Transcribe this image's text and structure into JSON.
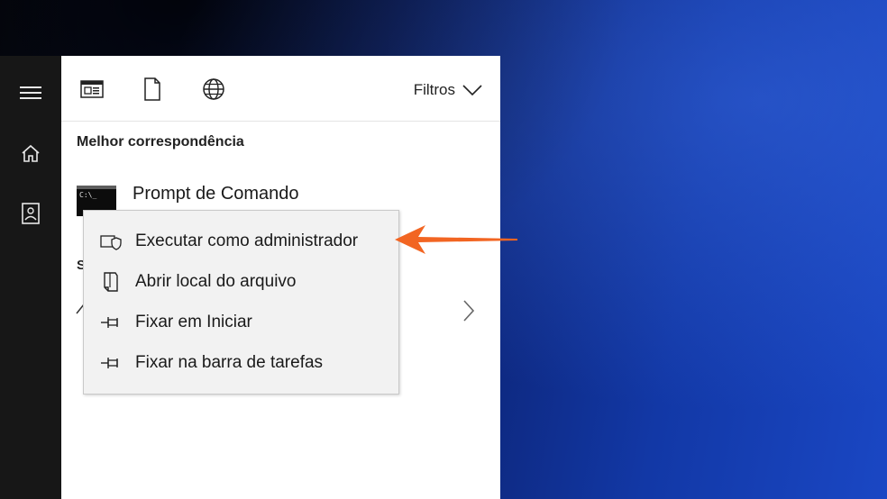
{
  "toolbar": {
    "icons": [
      "apps-icon",
      "document-icon",
      "web-icon"
    ],
    "filters_label": "Filtros"
  },
  "nav": {
    "icons": [
      "hamburger-menu-icon",
      "home-icon",
      "notebook-icon"
    ]
  },
  "best_match": {
    "section_title": "Melhor correspondência",
    "item_name": "Prompt de Comando",
    "item_icon_text": "C:\\_"
  },
  "partial": {
    "section_letter": "S"
  },
  "context_menu": {
    "items": [
      {
        "label": "Executar como administrador",
        "icon": "shield-icon"
      },
      {
        "label": "Abrir local do arquivo",
        "icon": "file-location-icon"
      },
      {
        "label": "Fixar em Iniciar",
        "icon": "pin-icon"
      },
      {
        "label": "Fixar na barra de tarefas",
        "icon": "pin-icon"
      }
    ]
  },
  "colors": {
    "arrow": "#f26522",
    "nav_rail": "#171717",
    "panel": "#ffffff",
    "menu_bg": "#f2f2f2"
  }
}
